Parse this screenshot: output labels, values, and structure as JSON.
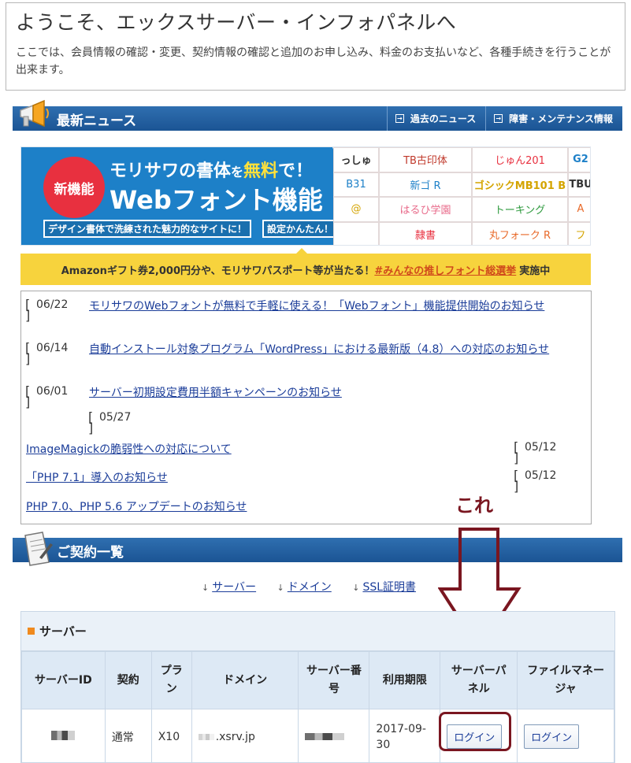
{
  "welcome": {
    "title": "ようこそ、エックスサーバー・インフォパネルへ",
    "description": "ここでは、会員情報の確認・変更、契約情報の確認と追加のお申し込み、料金のお支払いなど、各種手続きを行うことが出来ます。"
  },
  "news": {
    "title": "最新ニュース",
    "link_past": "過去のニュース",
    "link_maintenance": "障害・メンテナンス情報",
    "items": [
      {
        "date": "06/22",
        "text": "モリサワのWebフォントが無料で手軽に使える！「Webフォント」機能提供開始のお知らせ"
      },
      {
        "date": "06/14",
        "text": "自動インストール対象プログラム「WordPress」における最新版（4.8）への対応のお知らせ"
      },
      {
        "date": "06/01",
        "text": "サーバー初期設定費用半額キャンペーンのお知らせ"
      },
      {
        "date": "05/27",
        "text": "ImageMagickの脆弱性への対応について"
      },
      {
        "date": "05/12",
        "text": "「PHP 7.1」導入のお知らせ"
      },
      {
        "date": "05/12",
        "text": "PHP 7.0、PHP 5.6 アップデートのお知らせ"
      }
    ]
  },
  "banner": {
    "badge": "新機能",
    "headline_part1": "モリサワの書体",
    "headline_part2": "を",
    "headline_part3": "無料",
    "headline_part4": "で！",
    "headline2": "Webフォント機能",
    "tag1": "デザイン書体で洗練された魅力的なサイトに！",
    "tag2": "設定かんたん！",
    "fonts": [
      "っしゅ",
      "TB古印体",
      "じゅん201",
      "G2",
      "B31",
      "新ゴ R",
      "ゴシックMB101 B",
      "TBU",
      "@",
      "はるひ学園",
      "トーキング",
      "A",
      "",
      "隷書",
      "丸フォーク R",
      "フ"
    ]
  },
  "amazon": {
    "text_before": "Amazonギフト券2,000円分や、モリサワパスポート等が当たる！",
    "link": "#みんなの推しフォント総選挙",
    "text_after": "実施中"
  },
  "annotation": {
    "label": "これ"
  },
  "contracts": {
    "title": "ご契約一覧",
    "links": [
      "サーバー",
      "ドメイン",
      "SSL証明書"
    ],
    "server_section": "サーバー",
    "columns": [
      "サーバーID",
      "契約",
      "プラン",
      "ドメイン",
      "サーバー番号",
      "利用期限",
      "サーバーパネル",
      "ファイルマネージャ"
    ],
    "row": {
      "contract": "通常",
      "plan": "X10",
      "domain": ".xsrv.jp",
      "expiry": "2017-09-30",
      "panel_button": "ログイン",
      "file_button": "ログイン"
    }
  },
  "colors": {
    "header_blue": "#1b5494",
    "banner_blue": "#1d80c8",
    "badge_red": "#e8303f",
    "annotation_red": "#7a1620",
    "amazon_yellow": "#f7d33d",
    "link_blue": "#1b3d99"
  }
}
